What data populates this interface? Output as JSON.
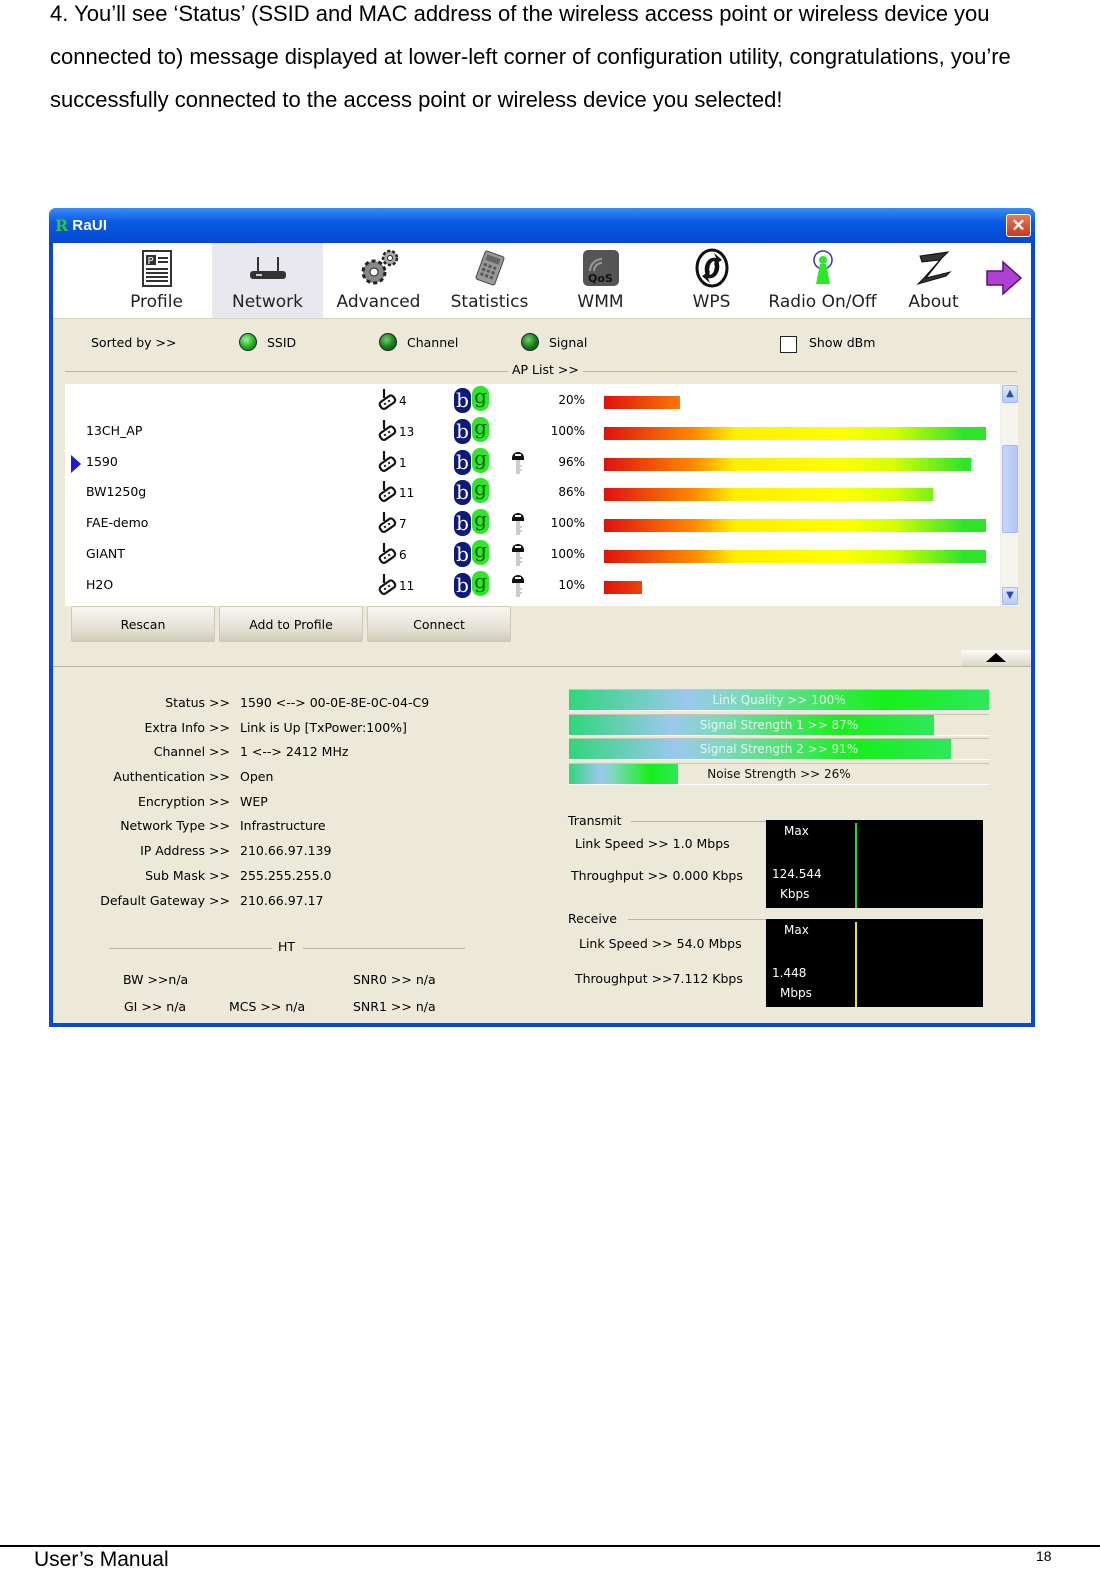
{
  "document": {
    "paragraph": "4. You’ll see ‘Status’ (SSID and MAC address of the wireless access point or wireless device you connected to) message displayed at lower-left corner of configuration utility, congratulations, you’re successfully connected to the access point or wireless device you selected!",
    "footer_left": "User’s Manual",
    "page_number": "18"
  },
  "window": {
    "logo": "R",
    "title": "RaUI",
    "close_glyph": "✕"
  },
  "toolbar": {
    "items": [
      {
        "label": "Profile",
        "icon": "profile-icon",
        "active": false
      },
      {
        "label": "Network",
        "icon": "router-icon",
        "active": true
      },
      {
        "label": "Advanced",
        "icon": "gears-icon",
        "active": false
      },
      {
        "label": "Statistics",
        "icon": "calculator-icon",
        "active": false
      },
      {
        "label": "WMM",
        "icon": "qos-icon",
        "active": false
      },
      {
        "label": "WPS",
        "icon": "wps-icon",
        "active": false
      },
      {
        "label": "Radio On/Off",
        "icon": "antenna-icon",
        "active": false
      },
      {
        "label": "About",
        "icon": "about-icon",
        "active": false
      }
    ],
    "next_icon": "arrow-right-icon"
  },
  "sort": {
    "label": "Sorted by >>",
    "options": [
      {
        "label": "SSID",
        "selected": true
      },
      {
        "label": "Channel",
        "selected": false
      },
      {
        "label": "Signal",
        "selected": false
      }
    ],
    "show_dbm_label": "Show dBm",
    "show_dbm_checked": false
  },
  "ap_list": {
    "title": "AP List >>",
    "rows": [
      {
        "ssid": "",
        "channel": "4",
        "modes": [
          "b",
          "g"
        ],
        "secured": false,
        "signal_pct": 20,
        "signal_text": "20%",
        "selected": false
      },
      {
        "ssid": "13CH_AP",
        "channel": "13",
        "modes": [
          "b",
          "g"
        ],
        "secured": false,
        "signal_pct": 100,
        "signal_text": "100%",
        "selected": false
      },
      {
        "ssid": "1590",
        "channel": "1",
        "modes": [
          "b",
          "g"
        ],
        "secured": true,
        "signal_pct": 96,
        "signal_text": "96%",
        "selected": true
      },
      {
        "ssid": "BW1250g",
        "channel": "11",
        "modes": [
          "b",
          "g"
        ],
        "secured": false,
        "signal_pct": 86,
        "signal_text": "86%",
        "selected": false
      },
      {
        "ssid": "FAE-demo",
        "channel": "7",
        "modes": [
          "b",
          "g"
        ],
        "secured": true,
        "signal_pct": 100,
        "signal_text": "100%",
        "selected": false
      },
      {
        "ssid": "GIANT",
        "channel": "6",
        "modes": [
          "b",
          "g"
        ],
        "secured": true,
        "signal_pct": 100,
        "signal_text": "100%",
        "selected": false
      },
      {
        "ssid": "H2O",
        "channel": "11",
        "modes": [
          "b",
          "g"
        ],
        "secured": true,
        "signal_pct": 10,
        "signal_text": "10%",
        "selected": false
      }
    ]
  },
  "buttons": {
    "rescan": "Rescan",
    "add_to_profile": "Add to Profile",
    "connect": "Connect"
  },
  "status": {
    "rows": [
      {
        "key": "Status >>",
        "value": "1590 <--> 00-0E-8E-0C-04-C9"
      },
      {
        "key": "Extra Info >>",
        "value": "Link is Up  [TxPower:100%]"
      },
      {
        "key": "Channel >>",
        "value": "1 <--> 2412 MHz"
      },
      {
        "key": "Authentication >>",
        "value": "Open"
      },
      {
        "key": "Encryption >>",
        "value": "WEP"
      },
      {
        "key": "Network Type >>",
        "value": "Infrastructure"
      },
      {
        "key": "IP Address >>",
        "value": "210.66.97.139"
      },
      {
        "key": "Sub Mask >>",
        "value": "255.255.255.0"
      },
      {
        "key": "Default Gateway >>",
        "value": "210.66.97.17"
      }
    ]
  },
  "meters": [
    {
      "label": "Link Quality >> 100%",
      "pct": 100
    },
    {
      "label": "Signal Strength 1 >> 87%",
      "pct": 87
    },
    {
      "label": "Signal Strength 2 >> 91%",
      "pct": 91
    },
    {
      "label": "Noise Strength >> 26%",
      "pct": 26
    }
  ],
  "transmit": {
    "title": "Transmit",
    "link_speed": "Link Speed >>  1.0 Mbps",
    "throughput": "Throughput >> 0.000 Kbps",
    "graph_max": "Max",
    "graph_value": "124.544",
    "graph_unit": "Kbps",
    "line_color": "#22dd22"
  },
  "receive": {
    "title": "Receive",
    "link_speed": "Link Speed >> 54.0 Mbps",
    "throughput": "Throughput >>7.112 Kbps",
    "graph_max": "Max",
    "graph_value": "1.448",
    "graph_unit": "Mbps",
    "line_color": "#f0e020"
  },
  "ht": {
    "title": "HT",
    "bw": "BW >>n/a",
    "gi": "GI >> n/a",
    "mcs": "MCS >>   n/a",
    "snr0": "SNR0 >>  n/a",
    "snr1": "SNR1 >> n/a"
  }
}
